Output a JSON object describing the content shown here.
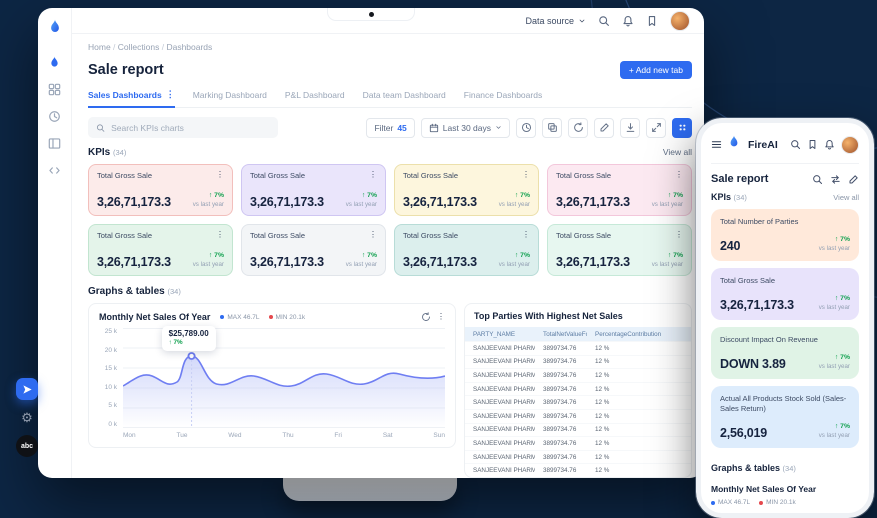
{
  "colors": {
    "accent": "#2e6bf0",
    "positive": "#12a150",
    "background": "#0d2644",
    "legend_max": "#2e6bf0",
    "legend_min": "#e5484d"
  },
  "desktop": {
    "topbar": {
      "data_source_label": "Data source",
      "icons": [
        "search",
        "bell",
        "bookmark",
        "avatar"
      ]
    },
    "sidebar_icons": [
      "fireai-logo",
      "fire",
      "grid",
      "history",
      "layout",
      "code"
    ],
    "breadcrumb": [
      "Home",
      "Collections",
      "Dashboards"
    ],
    "page_title": "Sale report",
    "add_tab_label": "+ Add new tab",
    "tabs": [
      {
        "label": "Sales Dashboards",
        "active": true
      },
      {
        "label": "Marking Dashboard"
      },
      {
        "label": "P&L Dashboard"
      },
      {
        "label": "Data team Dashboard"
      },
      {
        "label": "Finance Dashboards"
      }
    ],
    "toolbar": {
      "search_placeholder": "Search KPIs charts",
      "filter_label": "Filter",
      "filter_count": "45",
      "date_range": "Last 30 days",
      "icon_names": [
        "history",
        "copy",
        "refresh",
        "edit",
        "download",
        "expand",
        "apps-grid"
      ]
    },
    "kpis": {
      "heading": "KPIs",
      "count": "(34)",
      "view_all": "View all",
      "cards": [
        {
          "title": "Total Gross Sale",
          "value": "3,26,71,173.3",
          "delta": "↑ 7%",
          "sub": "vs last year",
          "bg": "#fcebea",
          "border": "#f2bfbc"
        },
        {
          "title": "Total Gross Sale",
          "value": "3,26,71,173.3",
          "delta": "↑ 7%",
          "sub": "vs last year",
          "bg": "#eae5fb",
          "border": "#cfc6f2"
        },
        {
          "title": "Total Gross Sale",
          "value": "3,26,71,173.3",
          "delta": "↑ 7%",
          "sub": "vs last year",
          "bg": "#fdf6dd",
          "border": "#ece0ab"
        },
        {
          "title": "Total Gross Sale",
          "value": "3,26,71,173.3",
          "delta": "↑ 7%",
          "sub": "vs last year",
          "bg": "#fce9f1",
          "border": "#f3c7db"
        },
        {
          "title": "Total Gross Sale",
          "value": "3,26,71,173.3",
          "delta": "↑ 7%",
          "sub": "vs last year",
          "bg": "#e4f4ea",
          "border": "#c2e5d0"
        },
        {
          "title": "Total Gross Sale",
          "value": "3,26,71,173.3",
          "delta": "↑ 7%",
          "sub": "vs last year",
          "bg": "#f3f5f7",
          "border": "#e1e5ea"
        },
        {
          "title": "Total Gross Sale",
          "value": "3,26,71,173.3",
          "delta": "↑ 7%",
          "sub": "vs last year",
          "bg": "#dcefed",
          "border": "#b8dcd7"
        },
        {
          "title": "Total Gross Sale",
          "value": "3,26,71,173.3",
          "delta": "↑ 7%",
          "sub": "vs last year",
          "bg": "#e7f7f0",
          "border": "#c6e9d8"
        }
      ]
    },
    "graphs": {
      "heading": "Graphs & tables",
      "count": "(34)"
    },
    "chart_card": {
      "title": "Monthly Net Sales Of Year",
      "legend": [
        {
          "label": "MAX 46.7L",
          "color": "#2e6bf0"
        },
        {
          "label": "MIN 20.1k",
          "color": "#e5484d"
        }
      ],
      "tooltip": {
        "value": "$25,789.00",
        "delta": "↑ 7%"
      },
      "y_ticks": [
        "25 k",
        "20 k",
        "15 k",
        "10 k",
        "5 k",
        "0 k"
      ],
      "x_ticks": [
        "Mon",
        "Tue",
        "Wed",
        "Thu",
        "Fri",
        "Sat",
        "Sun"
      ]
    },
    "table_card": {
      "title": "Top Parties With Highest Net Sales",
      "columns": [
        "PARTY_NAME",
        "TotalNetValueForParty",
        "PercentageContribution"
      ],
      "rows": [
        [
          "SANJEEVANI PHARMA DISTRIBUTORS",
          "3899734.76",
          "12 %"
        ],
        [
          "SANJEEVANI PHARMA DISTRIBUTORS",
          "3899734.76",
          "12 %"
        ],
        [
          "SANJEEVANI PHARMA DISTRIBUTORS",
          "3899734.76",
          "12 %"
        ],
        [
          "SANJEEVANI PHARMA DISTRIBUTORS",
          "3899734.76",
          "12 %"
        ],
        [
          "SANJEEVANI PHARMA DISTRIBUTORS",
          "3899734.76",
          "12 %"
        ],
        [
          "SANJEEVANI PHARMA DISTRIBUTORS",
          "3899734.76",
          "12 %"
        ],
        [
          "SANJEEVANI PHARMA DISTRIBUTORS",
          "3899734.76",
          "12 %"
        ],
        [
          "SANJEEVANI PHARMA DISTRIBUTORS",
          "3899734.76",
          "12 %"
        ],
        [
          "SANJEEVANI PHARMA DISTRIBUTORS",
          "3899734.76",
          "12 %"
        ],
        [
          "SANJEEVANI PHARMA DISTRIBUTORS",
          "3899734.76",
          "12 %"
        ]
      ]
    }
  },
  "phone": {
    "brand": "FireAI",
    "header_icons": [
      "search",
      "bookmark",
      "bell",
      "avatar"
    ],
    "page_title": "Sale report",
    "title_icons": [
      "search",
      "refresh",
      "edit"
    ],
    "kpis_heading": "KPIs",
    "kpis_count": "(34)",
    "view_all": "View all",
    "cards": [
      {
        "title": "Total Number of Parties",
        "value": "240",
        "delta": "↑ 7%",
        "sub": "vs last year",
        "bg": "#ffe9da"
      },
      {
        "title": "Total Gross Sale",
        "value": "3,26,71,173.3",
        "delta": "↑ 7%",
        "sub": "vs last year",
        "bg": "#e8e3fb"
      },
      {
        "title": "Discount Impact On Revenue",
        "value": "DOWN 3.89",
        "delta": "↑ 7%",
        "sub": "vs last year",
        "bg": "#e0f3e6"
      },
      {
        "title": "Actual All Products Stock Sold (Sales- Sales Return)",
        "value": "2,56,019",
        "delta": "↑ 7%",
        "sub": "vs last year",
        "bg": "#ddecfc"
      }
    ],
    "graphs_heading": "Graphs & tables",
    "graphs_count": "(34)",
    "chart_title": "Monthly Net Sales Of Year",
    "legend": [
      {
        "label": "MAX 46.7L",
        "color": "#2e6bf0"
      },
      {
        "label": "MIN 20.1k",
        "color": "#e5484d"
      }
    ]
  },
  "chart_data": {
    "type": "line",
    "title": "Monthly Net Sales Of Year",
    "x": [
      "Mon",
      "Tue",
      "Wed",
      "Thu",
      "Fri",
      "Sat",
      "Sun"
    ],
    "series": [
      {
        "name": "Net Sales",
        "values": [
          14000,
          25789,
          11500,
          15000,
          13000,
          16000,
          14500
        ]
      }
    ],
    "ylim": [
      0,
      25000
    ],
    "y_tick_labels": [
      "25 k",
      "20 k",
      "15 k",
      "10 k",
      "5 k",
      "0 k"
    ],
    "legend": [
      "MAX 46.7L",
      "MIN 20.1k"
    ],
    "annotations": [
      {
        "x": "Tue",
        "label": "$25,789.00",
        "delta": "↑ 7%"
      }
    ],
    "grid": true,
    "legend_position": "top"
  }
}
